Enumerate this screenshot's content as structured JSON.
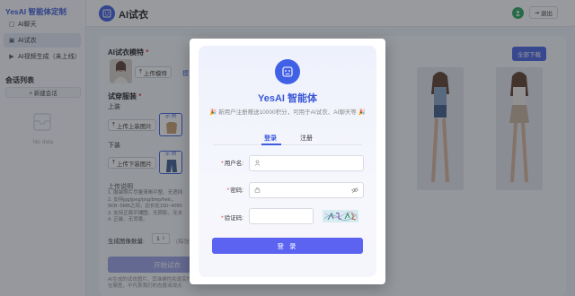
{
  "sidebar": {
    "brand": "YesAI 智能体定制",
    "items": [
      {
        "label": "AI聊天",
        "icon": "chat-icon"
      },
      {
        "label": "AI试衣",
        "icon": "shirt-icon"
      },
      {
        "label": "AI视频生成（未上线）",
        "icon": "video-icon"
      }
    ],
    "section_title": "会话列表",
    "new_chat": "+ 新建会话",
    "empty_text": "No data"
  },
  "header": {
    "title": "AI试衣",
    "user_initial": "",
    "logout": "退出"
  },
  "tryon": {
    "model_label": "AI试衣模特",
    "upload_model": "上传模特",
    "upload_model_suffix": "模",
    "clothes_label": "试穿服装",
    "top_label": "上装",
    "upload_top": "上传上装图片",
    "bottom_label": "下装",
    "upload_bottom": "上传下装图片",
    "example_tag": "示 例",
    "instructions_title": "上传说明",
    "instructions": [
      "1. 服装照片尽量清晰平整、无遮挡",
      "2. 支持jpg/jpeg/png/bmp/heic，",
      "5KB~5MB之间，边长在150~4096",
      "3. 支持正面平铺图、无阴影、无水",
      "4. 正装、无背景。"
    ],
    "count_label": "生成图像数量:",
    "count_value": "1",
    "count_hint": "(每张",
    "start_button": "开始试衣",
    "footer_note": "AI生成的试衣图片，其准确性和真实性可能存在偏差，不代表我们的态度或观点",
    "download_all": "全部下载"
  },
  "login_modal": {
    "title": "YesAI 智能体",
    "subtitle": "🎉 新用户注册赠送10000积分，可用于AI试衣、AI聊天等 🎉",
    "tabs": [
      "登录",
      "注册"
    ],
    "active_tab": 0,
    "username_label": "用户名:",
    "username_value": "",
    "password_label": "密码:",
    "password_value": "",
    "captcha_label": "验证码:",
    "captcha_value": "",
    "login_button": "登 录"
  },
  "colors": {
    "accent": "#3e5cde",
    "login_button": "#5b63f0",
    "user_avatar": "#2aa55a"
  }
}
